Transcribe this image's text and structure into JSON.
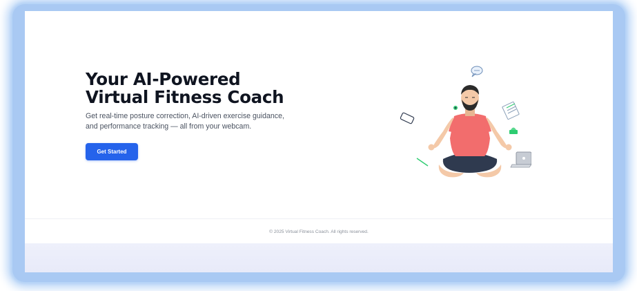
{
  "hero": {
    "title_line1": "Your AI-Powered",
    "title_line2": "Virtual Fitness Coach",
    "subtitle_line1": "Get real-time posture correction, AI-driven exercise guidance,",
    "subtitle_line2": "and performance tracking — all from your webcam.",
    "cta_label": "Get Started"
  },
  "illustration": {
    "icon": "meditating-person-illustration",
    "colors": {
      "shirt": "#f26d6d",
      "pants": "#2f3a4f",
      "skin": "#f4c9a8",
      "hair": "#2b2b2b",
      "accent": "#2ecc71"
    }
  },
  "footer": {
    "copyright": "© 2025 Virtual Fitness Coach. All rights reserved."
  },
  "colors": {
    "accent": "#2563eb",
    "frame_glow": "#a9c9f3",
    "title": "#0f1420"
  }
}
